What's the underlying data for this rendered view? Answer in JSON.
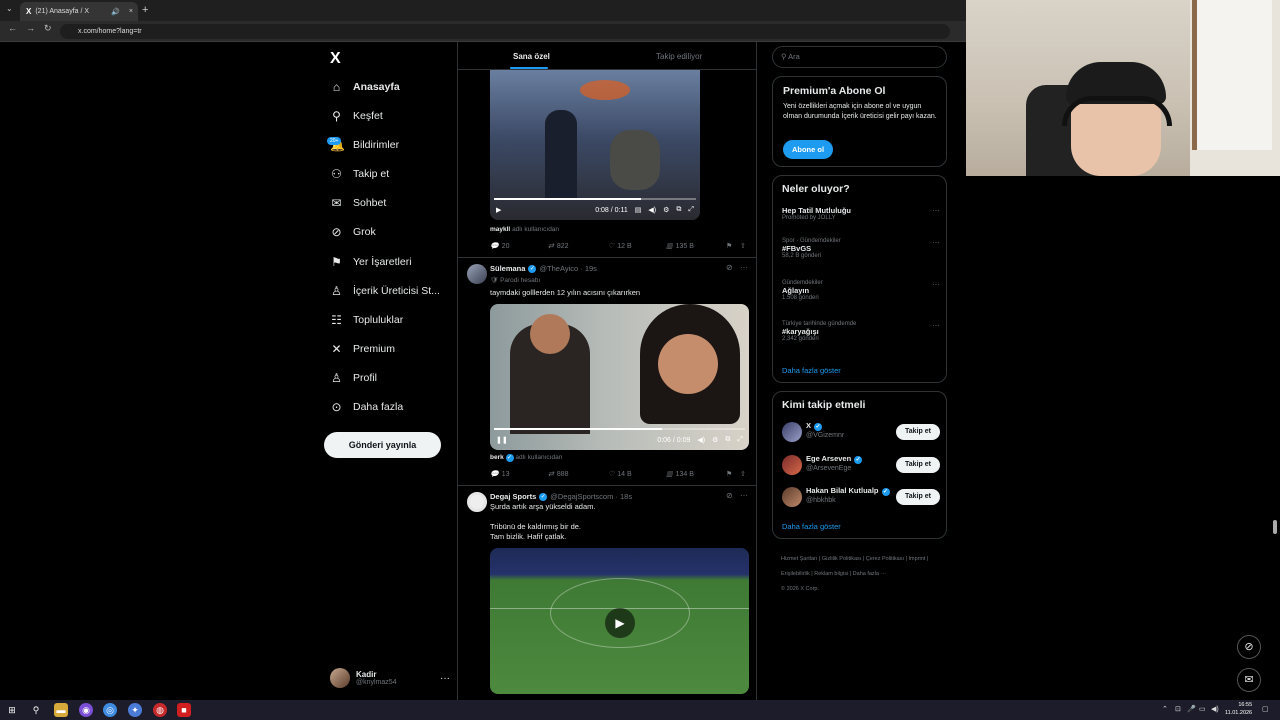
{
  "browser": {
    "tab_title": "(21) Anasayfa / X",
    "tab_logo": "X",
    "url": "x.com/home?lang=tr",
    "new_tab_icon": "+",
    "close_tab_icon": "×"
  },
  "sidebar": {
    "logo": "X",
    "items": [
      {
        "label": "Anasayfa",
        "icon": "home-icon",
        "glyph": "⌂"
      },
      {
        "label": "Keşfet",
        "icon": "search-icon",
        "glyph": "⚲"
      },
      {
        "label": "Bildirimler",
        "icon": "bell-icon",
        "glyph": "🔔"
      },
      {
        "label": "Takip et",
        "icon": "follow-icon",
        "glyph": "⚇"
      },
      {
        "label": "Sohbet",
        "icon": "mail-icon",
        "glyph": "✉"
      },
      {
        "label": "Grok",
        "icon": "grok-icon",
        "glyph": "⊘"
      },
      {
        "label": "Yer İşaretleri",
        "icon": "bookmark-icon",
        "glyph": "⚑"
      },
      {
        "label": "İçerik Üreticisi St...",
        "icon": "creator-icon",
        "glyph": "♙"
      },
      {
        "label": "Topluluklar",
        "icon": "communities-icon",
        "glyph": "☷"
      },
      {
        "label": "Premium",
        "icon": "x-premium-icon",
        "glyph": "✕"
      },
      {
        "label": "Profil",
        "icon": "profile-icon",
        "glyph": "♙"
      },
      {
        "label": "Daha fazla",
        "icon": "more-circle-icon",
        "glyph": "⊙"
      }
    ],
    "notif_badge": "20+",
    "post_button": "Gönderi yayınla",
    "account": {
      "name": "Kadir",
      "handle": "@knylmaz54",
      "more": "···"
    }
  },
  "timeline": {
    "tabs": {
      "for_you": "Sana özel",
      "following": "Takip ediliyor"
    },
    "post1": {
      "time": "0:08 / 0:11",
      "byline_user": "maykll",
      "byline_text": "adlı kullanıcıdan",
      "replies": "20",
      "reposts": "822",
      "likes": "12 B",
      "views": "135 B",
      "progress": 0.73
    },
    "post2": {
      "name": "Sülemana",
      "handle": "@TheAyico · 19s",
      "parody": "Parodi hesabı",
      "text": "taymdaki golllerden 12 yılın acısını çıkarırken",
      "time": "0:06 / 0:09",
      "byline_user": "berk",
      "byline_text": "adlı kullanıcıdan",
      "replies": "13",
      "reposts": "888",
      "likes": "14 B",
      "views": "134 B",
      "progress": 0.67
    },
    "post3": {
      "name": "Degaj Sports",
      "handle": "@DegajSportscom · 18s",
      "text1": "Şurda artık arşa yükseldi adam.",
      "text2": "Tribünü de kaldırmış bir de.",
      "text3": "Tam bizlik. Hafif çatlak."
    }
  },
  "right": {
    "search_placeholder": "Ara",
    "premium": {
      "title": "Premium'a Abone Ol",
      "body": "Yeni özellikleri açmak için abone ol ve uygun olman durumunda İçerik üreticisi gelir payı kazan.",
      "button": "Abone ol"
    },
    "trends": {
      "title": "Neler oluyor?",
      "items": [
        {
          "meta": "Promoted by JOLLY",
          "name": "Hep Tatil Mutluluğu",
          "count": ""
        },
        {
          "meta": "Spor · Gündemdekiler",
          "name": "#FBvGS",
          "count": "58,2 B gönderi"
        },
        {
          "meta": "Gündemdekiler",
          "name": "Ağlayın",
          "count": "1.508 gönderi"
        },
        {
          "meta": "Türkiye tarihinde gündemde",
          "name": "#karyağışı",
          "count": "2.342 gönderi"
        }
      ],
      "more": "Daha fazla göster"
    },
    "who_to_follow": {
      "title": "Kimi takip etmeli",
      "items": [
        {
          "name": "X",
          "handle": "@VGizemnr"
        },
        {
          "name": "Ege Arseven",
          "handle": "@ArsevenEge"
        },
        {
          "name": "Hakan Bilal Kutlualp",
          "handle": "@hbkhbk"
        }
      ],
      "follow_label": "Takip et",
      "more": "Daha fazla göster"
    },
    "footer": {
      "l1": "Hizmet Şartları",
      "l2": "Gizlilik Politikası",
      "l3": "Çerez Politikası",
      "l4": "Imprint",
      "l5": "Erişilebilirlik",
      "l6": "Reklam bilgisi",
      "l7": "Daha fazla ···",
      "copy": "© 2026 X Corp."
    }
  },
  "taskbar": {
    "time": "16:55",
    "date": "11.01.2026"
  },
  "colors": {
    "accent": "#1d9bf0",
    "bg": "#000000",
    "border": "#2f3336"
  }
}
